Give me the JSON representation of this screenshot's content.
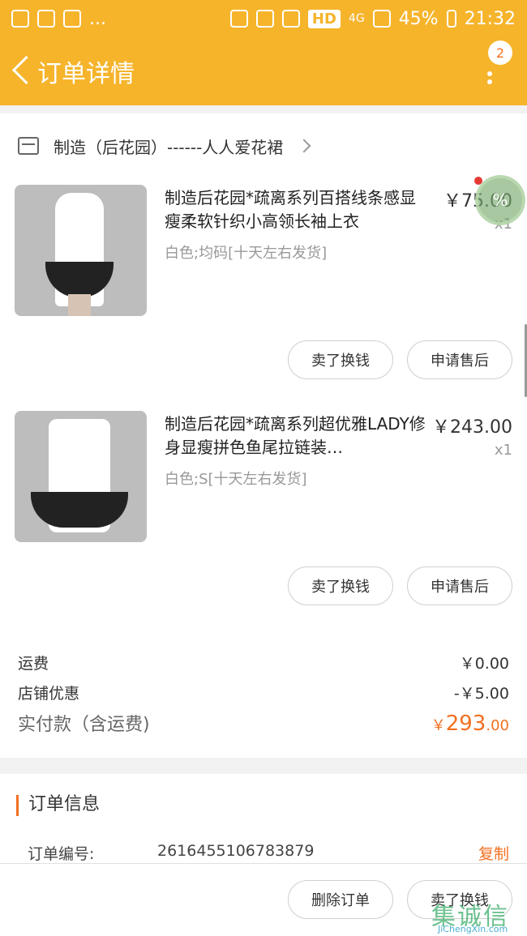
{
  "status_bar": {
    "dots": "...",
    "hd": "HD",
    "network": "4G",
    "battery": "45%",
    "time": "21:32"
  },
  "header": {
    "title": "订单详情",
    "badge_count": "2"
  },
  "shop": {
    "name": "制造（后花园）------人人爱花裙"
  },
  "items": [
    {
      "name": "制造后花园*疏离系列百搭线条感显瘦柔软针织小高领长袖上衣",
      "attributes": "白色;均码[十天左右发货]",
      "price": "￥75.00",
      "quantity": "x1",
      "sell_button": "卖了换钱",
      "after_sale_button": "申请售后"
    },
    {
      "name": "制造后花园*疏离系列超优雅LADY修身显瘦拼色鱼尾拉链装…",
      "attributes": "白色;S[十天左右发货]",
      "price": "￥243.00",
      "quantity": "x1",
      "sell_button": "卖了换钱",
      "after_sale_button": "申请售后"
    }
  ],
  "fees": {
    "shipping_label": "运费",
    "shipping_value": "￥0.00",
    "discount_label": "店铺优惠",
    "discount_value": "-￥5.00",
    "total_label": "实付款（含运费)",
    "total_currency": "￥",
    "total_integer": "293",
    "total_decimal": ".00"
  },
  "order_info": {
    "title": "订单信息",
    "order_no_label": "订单编号:",
    "order_no_value": "2616455106783879",
    "copy_label": "复制"
  },
  "bottom_bar": {
    "delete_button": "删除订单",
    "sell_button": "卖了换钱"
  },
  "floating": {
    "text": "%"
  },
  "watermark": {
    "logo": "集诚信",
    "url": "JiChengXin.com"
  },
  "colors": {
    "header_bg": "#f6b42b",
    "accent": "#f37021"
  }
}
